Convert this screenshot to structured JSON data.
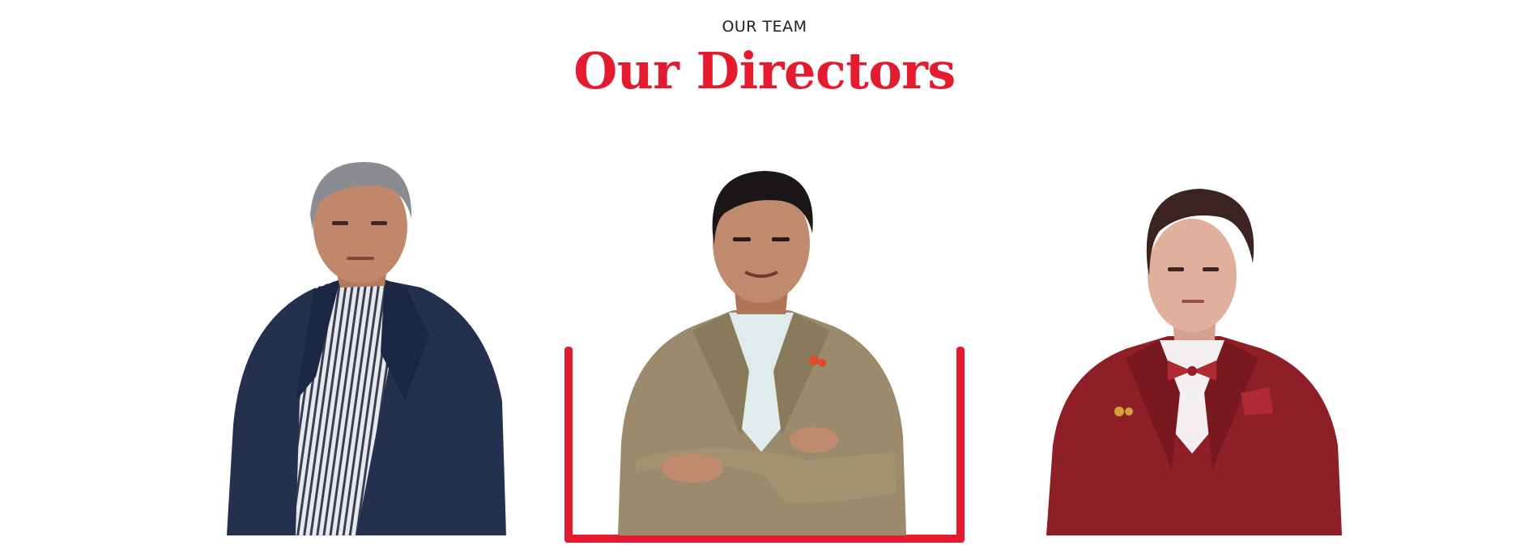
{
  "section": {
    "eyebrow": "OUR TEAM",
    "title": "Our Directors"
  },
  "directors": [
    {
      "photo": "director-photo-1",
      "jacket_color": "#23314f"
    },
    {
      "photo": "director-photo-2",
      "jacket_color": "#9b8a6b"
    },
    {
      "photo": "director-photo-3",
      "jacket_color": "#8e1f27"
    }
  ],
  "colors": {
    "accent": "#e41b2f",
    "text": "#1f1f1f",
    "background": "#ffffff"
  }
}
